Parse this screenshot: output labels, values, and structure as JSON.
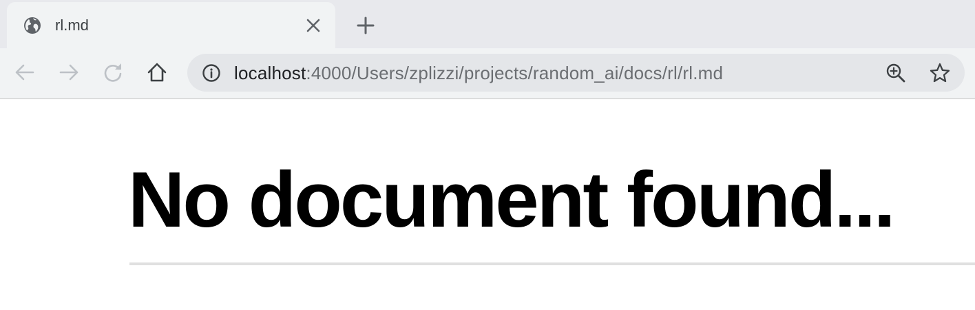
{
  "tab": {
    "title": "rl.md",
    "favicon": "globe-icon",
    "close_icon": "close-icon"
  },
  "new_tab_icon": "plus-icon",
  "toolbar": {
    "back_icon": "arrow-left-icon",
    "forward_icon": "arrow-right-icon",
    "reload_icon": "reload-icon",
    "home_icon": "home-icon",
    "zoom_icon": "zoom-in-icon",
    "bookmark_icon": "star-icon"
  },
  "address_bar": {
    "info_icon": "info-icon",
    "host": "localhost",
    "rest": ":4000/Users/zplizzi/projects/random_ai/docs/rl/rl.md"
  },
  "page": {
    "heading": "No document found..."
  },
  "colors": {
    "tabstrip_bg": "#e8e9ed",
    "active_tab_bg": "#f1f3f4",
    "omnibox_bg": "#e4e6e9",
    "url_host": "#202124",
    "url_rest": "#6b6e72",
    "heading": "#000000",
    "rule": "#e0e0e0"
  }
}
